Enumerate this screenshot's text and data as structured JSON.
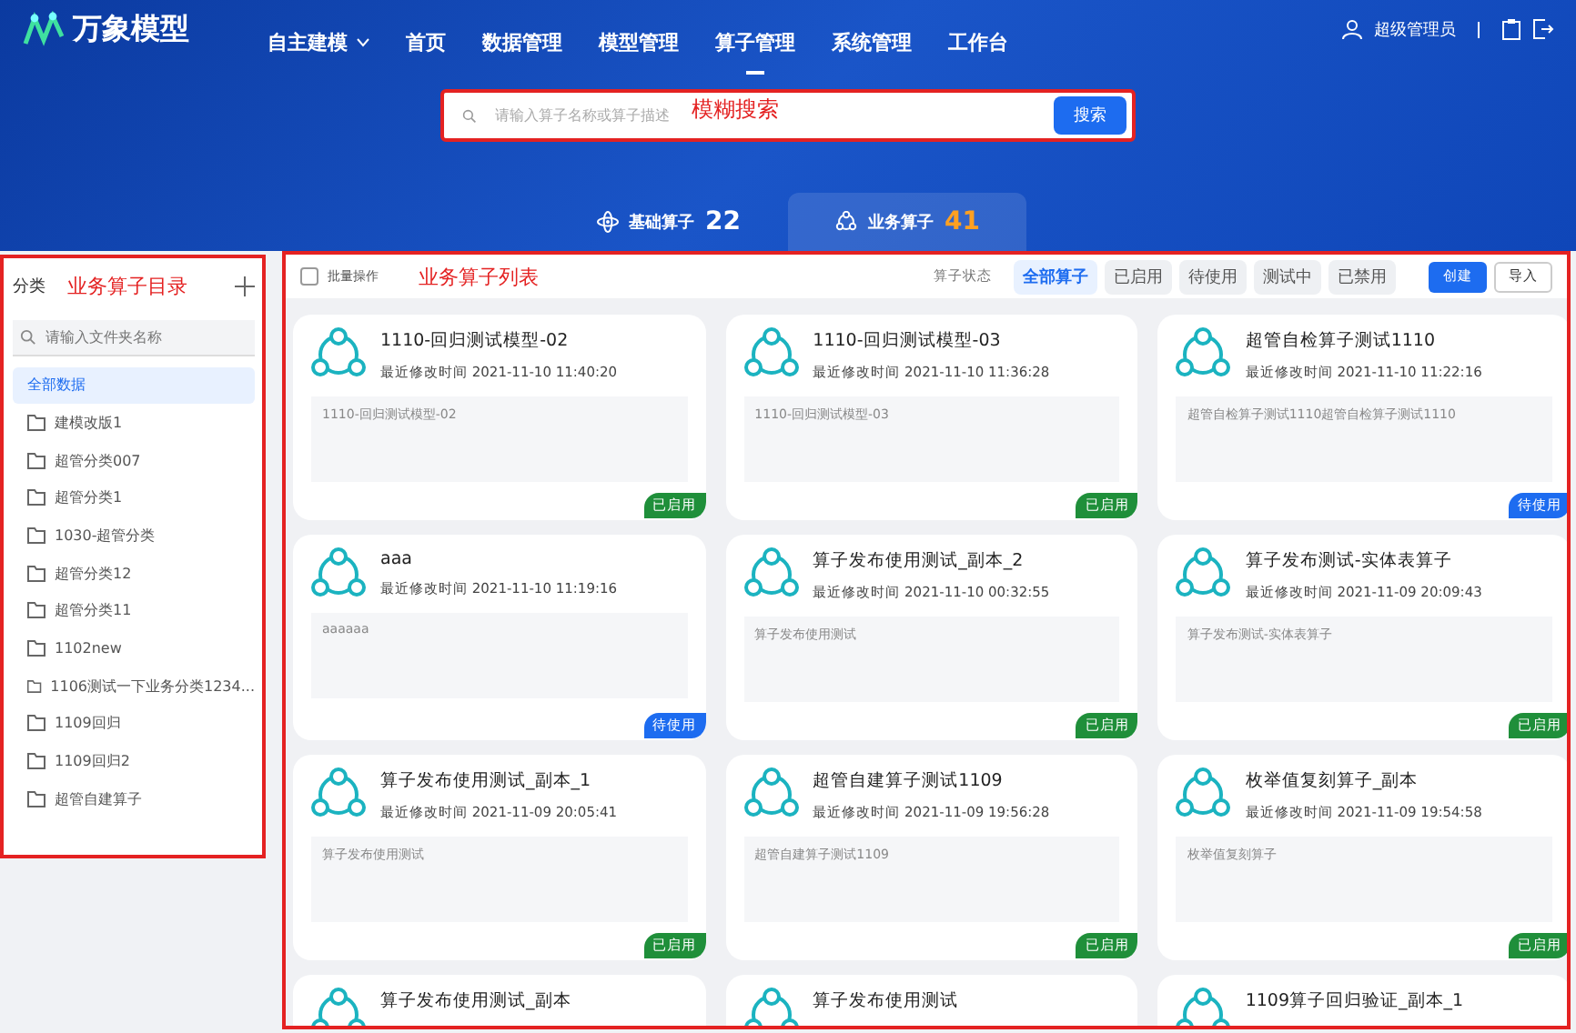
{
  "header": {
    "logo": "万象模型",
    "nav": [
      {
        "label": "自主建模",
        "selected": false,
        "dropdown": true
      },
      {
        "label": "首页",
        "selected": false,
        "dropdown": false
      },
      {
        "label": "数据管理",
        "selected": false,
        "dropdown": false
      },
      {
        "label": "模型管理",
        "selected": false,
        "dropdown": false
      },
      {
        "label": "算子管理",
        "selected": true,
        "dropdown": false
      },
      {
        "label": "系统管理",
        "selected": false,
        "dropdown": false
      },
      {
        "label": "工作台",
        "selected": false,
        "dropdown": false
      }
    ],
    "user": "超级管理员"
  },
  "search": {
    "placeholder": "请输入算子名称或算子描述",
    "button": "搜索",
    "annotation": "模糊搜索"
  },
  "type_tabs": [
    {
      "label": "基础算子",
      "count": "22",
      "selected": false
    },
    {
      "label": "业务算子",
      "count": "41",
      "selected": true
    }
  ],
  "sidebar": {
    "title": "分类",
    "annotation": "业务算子目录",
    "search_placeholder": "请输入文件夹名称",
    "all": {
      "label": "全部数据",
      "selected": true
    },
    "folders": [
      "建模改版1",
      "超管分类007",
      "超管分类1",
      "1030-超管分类",
      "超管分类12",
      "超管分类11",
      "1102new",
      "1106测试一下业务分类1234...",
      "1109回归",
      "1109回归2",
      "超管自建算子"
    ]
  },
  "toolbar": {
    "batch": {
      "label": "批量操作",
      "checked": false
    },
    "annotation": "业务算子列表",
    "status_label": "算子状态",
    "filters": [
      {
        "label": "全部算子",
        "selected": true
      },
      {
        "label": "已启用",
        "selected": false
      },
      {
        "label": "待使用",
        "selected": false
      },
      {
        "label": "测试中",
        "selected": false
      },
      {
        "label": "已禁用",
        "selected": false
      }
    ],
    "create": "创建",
    "import": "导入"
  },
  "cards": [
    {
      "title": "1110-回归测试模型-02",
      "modified": "最近修改时间 2021-11-10 11:40:20",
      "description": "1110-回归测试模型-02",
      "status": {
        "label": "已启用",
        "kind": "enabled"
      }
    },
    {
      "title": "1110-回归测试模型-03",
      "modified": "最近修改时间 2021-11-10 11:36:28",
      "description": "1110-回归测试模型-03",
      "status": {
        "label": "已启用",
        "kind": "enabled"
      }
    },
    {
      "title": "超管自检算子测试1110",
      "modified": "最近修改时间 2021-11-10 11:22:16",
      "description": "超管自检算子测试1110超管自检算子测试1110",
      "status": {
        "label": "待使用",
        "kind": "pending"
      }
    },
    {
      "title": "aaa",
      "modified": "最近修改时间 2021-11-10 11:19:16",
      "description": "aaaaaa",
      "status": {
        "label": "待使用",
        "kind": "pending"
      }
    },
    {
      "title": "算子发布使用测试_副本_2",
      "modified": "最近修改时间 2021-11-10 00:32:55",
      "description": "算子发布使用测试",
      "status": {
        "label": "已启用",
        "kind": "enabled"
      }
    },
    {
      "title": "算子发布测试-实体表算子",
      "modified": "最近修改时间 2021-11-09 20:09:43",
      "description": "算子发布测试-实体表算子",
      "status": {
        "label": "已启用",
        "kind": "enabled"
      }
    },
    {
      "title": "算子发布使用测试_副本_1",
      "modified": "最近修改时间 2021-11-09 20:05:41",
      "description": "算子发布使用测试",
      "status": {
        "label": "已启用",
        "kind": "enabled"
      }
    },
    {
      "title": "超管自建算子测试1109",
      "modified": "最近修改时间 2021-11-09 19:56:28",
      "description": "超管自建算子测试1109",
      "status": {
        "label": "已启用",
        "kind": "enabled"
      }
    },
    {
      "title": "枚举值复刻算子_副本",
      "modified": "最近修改时间 2021-11-09 19:54:58",
      "description": "枚举值复刻算子",
      "status": {
        "label": "已启用",
        "kind": "enabled"
      }
    },
    {
      "title": "算子发布使用测试_副本"
    },
    {
      "title": "算子发布使用测试"
    },
    {
      "title": "1109算子回归验证_副本_1"
    }
  ]
}
